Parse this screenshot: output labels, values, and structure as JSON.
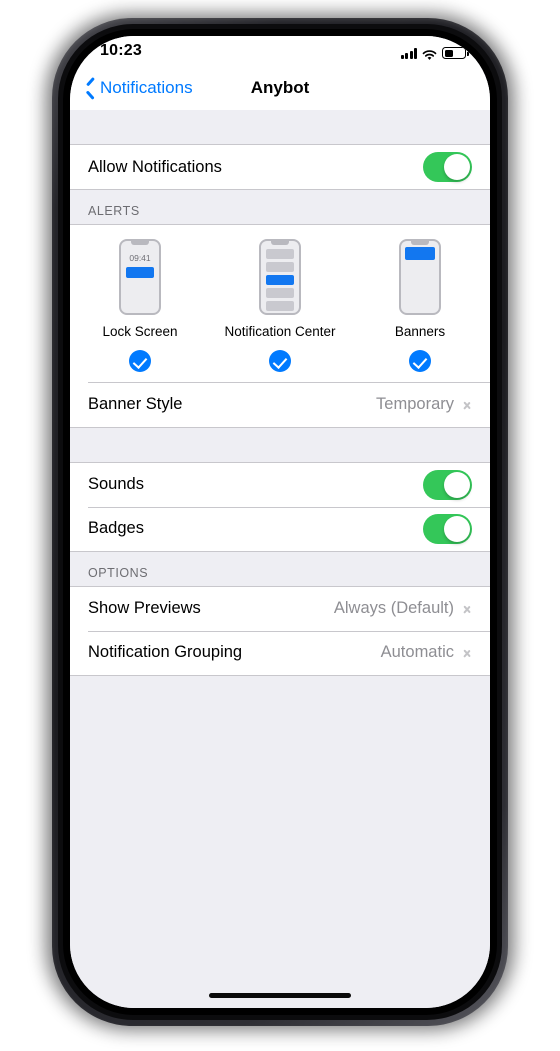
{
  "status_bar": {
    "time": "10:23",
    "signal_icon": "cellular-bars-icon",
    "wifi_icon": "wifi-icon",
    "battery_icon": "battery-icon",
    "battery_level_percent": 45
  },
  "nav_bar": {
    "back_label": "Notifications",
    "back_icon": "chevron-left-icon",
    "title": "Anybot"
  },
  "colors": {
    "accent_blue": "#007aff",
    "toggle_green": "#34c759",
    "preview_blue": "#1277f0",
    "group_background": "#eeeef3",
    "row_background": "#ffffff",
    "secondary_text": "#8e8e93"
  },
  "sections": {
    "allow": {
      "rows": [
        {
          "label": "Allow Notifications",
          "type": "toggle",
          "value": "on"
        }
      ]
    },
    "alerts": {
      "header": "ALERTS",
      "options": [
        {
          "label": "Lock Screen",
          "preview": "lock-screen-preview",
          "preview_time": "09:41",
          "checked": true
        },
        {
          "label": "Notification Center",
          "preview": "notification-center-preview",
          "preview_time": "",
          "checked": true
        },
        {
          "label": "Banners",
          "preview": "banners-preview",
          "preview_time": "",
          "checked": true
        }
      ],
      "banner_style": {
        "label": "Banner Style",
        "value": "Temporary",
        "chevron_icon": "chevron-right-icon"
      }
    },
    "sounds_badges": {
      "rows": [
        {
          "label": "Sounds",
          "type": "toggle",
          "value": "on"
        },
        {
          "label": "Badges",
          "type": "toggle",
          "value": "on"
        }
      ]
    },
    "options": {
      "header": "OPTIONS",
      "rows": [
        {
          "label": "Show Previews",
          "value": "Always (Default)",
          "chevron_icon": "chevron-right-icon"
        },
        {
          "label": "Notification Grouping",
          "value": "Automatic",
          "chevron_icon": "chevron-right-icon"
        }
      ]
    }
  },
  "home_indicator": "home-indicator"
}
